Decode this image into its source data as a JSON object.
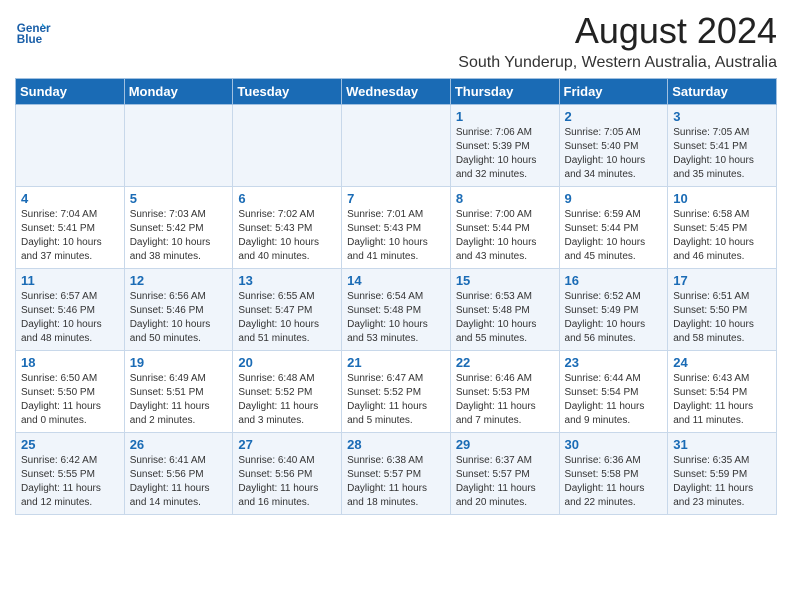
{
  "header": {
    "logo_line1": "General",
    "logo_line2": "Blue",
    "title": "August 2024",
    "subtitle": "South Yunderup, Western Australia, Australia"
  },
  "weekdays": [
    "Sunday",
    "Monday",
    "Tuesday",
    "Wednesday",
    "Thursday",
    "Friday",
    "Saturday"
  ],
  "weeks": [
    [
      {
        "day": "",
        "info": ""
      },
      {
        "day": "",
        "info": ""
      },
      {
        "day": "",
        "info": ""
      },
      {
        "day": "",
        "info": ""
      },
      {
        "day": "1",
        "info": "Sunrise: 7:06 AM\nSunset: 5:39 PM\nDaylight: 10 hours\nand 32 minutes."
      },
      {
        "day": "2",
        "info": "Sunrise: 7:05 AM\nSunset: 5:40 PM\nDaylight: 10 hours\nand 34 minutes."
      },
      {
        "day": "3",
        "info": "Sunrise: 7:05 AM\nSunset: 5:41 PM\nDaylight: 10 hours\nand 35 minutes."
      }
    ],
    [
      {
        "day": "4",
        "info": "Sunrise: 7:04 AM\nSunset: 5:41 PM\nDaylight: 10 hours\nand 37 minutes."
      },
      {
        "day": "5",
        "info": "Sunrise: 7:03 AM\nSunset: 5:42 PM\nDaylight: 10 hours\nand 38 minutes."
      },
      {
        "day": "6",
        "info": "Sunrise: 7:02 AM\nSunset: 5:43 PM\nDaylight: 10 hours\nand 40 minutes."
      },
      {
        "day": "7",
        "info": "Sunrise: 7:01 AM\nSunset: 5:43 PM\nDaylight: 10 hours\nand 41 minutes."
      },
      {
        "day": "8",
        "info": "Sunrise: 7:00 AM\nSunset: 5:44 PM\nDaylight: 10 hours\nand 43 minutes."
      },
      {
        "day": "9",
        "info": "Sunrise: 6:59 AM\nSunset: 5:44 PM\nDaylight: 10 hours\nand 45 minutes."
      },
      {
        "day": "10",
        "info": "Sunrise: 6:58 AM\nSunset: 5:45 PM\nDaylight: 10 hours\nand 46 minutes."
      }
    ],
    [
      {
        "day": "11",
        "info": "Sunrise: 6:57 AM\nSunset: 5:46 PM\nDaylight: 10 hours\nand 48 minutes."
      },
      {
        "day": "12",
        "info": "Sunrise: 6:56 AM\nSunset: 5:46 PM\nDaylight: 10 hours\nand 50 minutes."
      },
      {
        "day": "13",
        "info": "Sunrise: 6:55 AM\nSunset: 5:47 PM\nDaylight: 10 hours\nand 51 minutes."
      },
      {
        "day": "14",
        "info": "Sunrise: 6:54 AM\nSunset: 5:48 PM\nDaylight: 10 hours\nand 53 minutes."
      },
      {
        "day": "15",
        "info": "Sunrise: 6:53 AM\nSunset: 5:48 PM\nDaylight: 10 hours\nand 55 minutes."
      },
      {
        "day": "16",
        "info": "Sunrise: 6:52 AM\nSunset: 5:49 PM\nDaylight: 10 hours\nand 56 minutes."
      },
      {
        "day": "17",
        "info": "Sunrise: 6:51 AM\nSunset: 5:50 PM\nDaylight: 10 hours\nand 58 minutes."
      }
    ],
    [
      {
        "day": "18",
        "info": "Sunrise: 6:50 AM\nSunset: 5:50 PM\nDaylight: 11 hours\nand 0 minutes."
      },
      {
        "day": "19",
        "info": "Sunrise: 6:49 AM\nSunset: 5:51 PM\nDaylight: 11 hours\nand 2 minutes."
      },
      {
        "day": "20",
        "info": "Sunrise: 6:48 AM\nSunset: 5:52 PM\nDaylight: 11 hours\nand 3 minutes."
      },
      {
        "day": "21",
        "info": "Sunrise: 6:47 AM\nSunset: 5:52 PM\nDaylight: 11 hours\nand 5 minutes."
      },
      {
        "day": "22",
        "info": "Sunrise: 6:46 AM\nSunset: 5:53 PM\nDaylight: 11 hours\nand 7 minutes."
      },
      {
        "day": "23",
        "info": "Sunrise: 6:44 AM\nSunset: 5:54 PM\nDaylight: 11 hours\nand 9 minutes."
      },
      {
        "day": "24",
        "info": "Sunrise: 6:43 AM\nSunset: 5:54 PM\nDaylight: 11 hours\nand 11 minutes."
      }
    ],
    [
      {
        "day": "25",
        "info": "Sunrise: 6:42 AM\nSunset: 5:55 PM\nDaylight: 11 hours\nand 12 minutes."
      },
      {
        "day": "26",
        "info": "Sunrise: 6:41 AM\nSunset: 5:56 PM\nDaylight: 11 hours\nand 14 minutes."
      },
      {
        "day": "27",
        "info": "Sunrise: 6:40 AM\nSunset: 5:56 PM\nDaylight: 11 hours\nand 16 minutes."
      },
      {
        "day": "28",
        "info": "Sunrise: 6:38 AM\nSunset: 5:57 PM\nDaylight: 11 hours\nand 18 minutes."
      },
      {
        "day": "29",
        "info": "Sunrise: 6:37 AM\nSunset: 5:57 PM\nDaylight: 11 hours\nand 20 minutes."
      },
      {
        "day": "30",
        "info": "Sunrise: 6:36 AM\nSunset: 5:58 PM\nDaylight: 11 hours\nand 22 minutes."
      },
      {
        "day": "31",
        "info": "Sunrise: 6:35 AM\nSunset: 5:59 PM\nDaylight: 11 hours\nand 23 minutes."
      }
    ]
  ]
}
